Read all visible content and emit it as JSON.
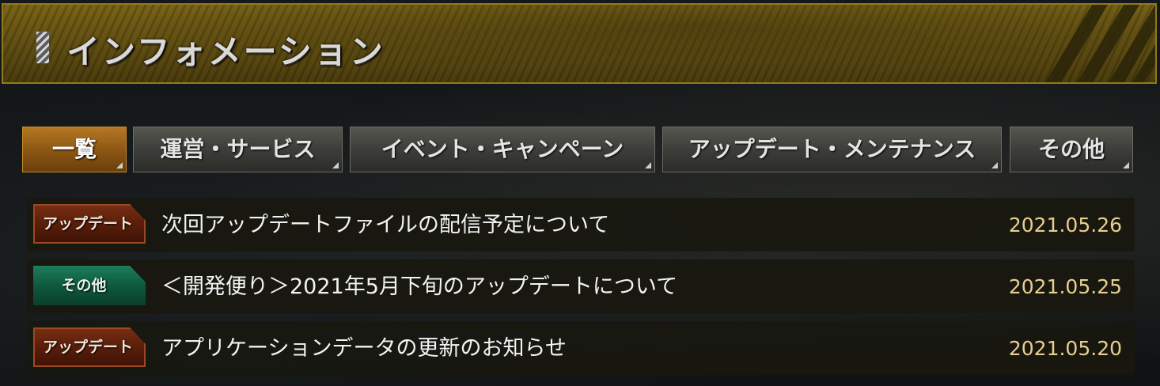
{
  "header": {
    "title": "インフォメーション"
  },
  "tabs": [
    {
      "label": "一覧",
      "active": true
    },
    {
      "label": "運営・サービス",
      "active": false
    },
    {
      "label": "イベント・キャンペーン",
      "active": false
    },
    {
      "label": "アップデート・メンテナンス",
      "active": false
    },
    {
      "label": "その他",
      "active": false
    }
  ],
  "news": [
    {
      "badge": "アップデート",
      "badge_type": "update",
      "title": "次回アップデートファイルの配信予定について",
      "date": "2021.05.26"
    },
    {
      "badge": "その他",
      "badge_type": "other",
      "title": "＜開発便り＞2021年5月下旬のアップデートについて",
      "date": "2021.05.25"
    },
    {
      "badge": "アップデート",
      "badge_type": "update",
      "title": "アプリケーションデータの更新のお知らせ",
      "date": "2021.05.20"
    }
  ],
  "colors": {
    "header_gold": "#6b5716",
    "active_tab": "#8a5513",
    "update_badge": "#5a1e0a",
    "other_badge": "#0f5a3e",
    "date_text": "#e9cf8e"
  }
}
